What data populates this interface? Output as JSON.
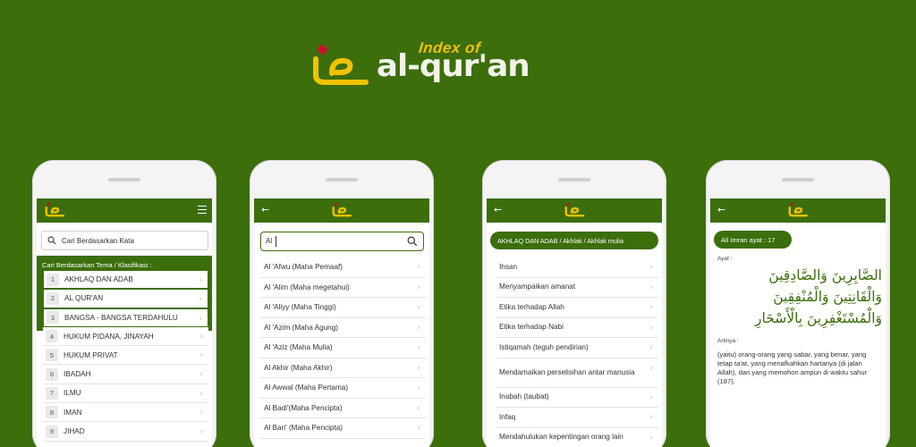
{
  "banner": {
    "index_of": "Index of",
    "title": "al-qur'an"
  },
  "phone1": {
    "search_placeholder": "Cari Berdasarkan Kata",
    "category_caption": "Cari Berdasarkan Tema / Klasifikasi :",
    "categories": [
      {
        "num": "1",
        "label": "AKHLAQ DAN ADAB"
      },
      {
        "num": "2",
        "label": "AL QUR'AN"
      },
      {
        "num": "3",
        "label": "BANGSA - BANGSA TERDAHULU"
      },
      {
        "num": "4",
        "label": "HUKUM PIDANA, JINAYAH"
      },
      {
        "num": "5",
        "label": "HUKUM PRIVAT"
      },
      {
        "num": "6",
        "label": "IBADAH"
      },
      {
        "num": "7",
        "label": "ILMU"
      },
      {
        "num": "8",
        "label": "IMAN"
      },
      {
        "num": "9",
        "label": "JIHAD"
      }
    ]
  },
  "phone2": {
    "search_value": "Al",
    "names": [
      "Al 'Afwu (Maha Pemaaf)",
      "Al 'Alim (Maha megetahui)",
      "Al 'Aliyy (Maha Tinggi)",
      "Al 'Azim (Maha Agung)",
      "Al 'Aziz (Maha Mulia)",
      "Al Akhir (Maha Akhir)",
      "Al Awwal (Maha Pertama)",
      "Al Badi'(Maha Pencipta)",
      "Al Bari' (Maha Pencipta)"
    ]
  },
  "phone3": {
    "breadcrumb": "AKHLAQ DAN ADAB / Akhlak / Akhlak mulia",
    "topics": [
      "Ihsan",
      "Menyampaikan amanat",
      "Etika terhadap Allah",
      "Etika terhadap Nabi",
      "Istiqamah (teguh pendirian)",
      "Mendamaikan perselisihan antar manusia",
      "Inabah (taubat)",
      "Infaq",
      "Mendahulukan kepentingan orang lain"
    ]
  },
  "phone4": {
    "verse_ref": "Ali Imran ayat : 17",
    "ayat_label": "Ayat :",
    "arabic_text": "الصَّابِرِينَ وَالصَّادِقِينَ وَالْقَانِتِينَ وَالْمُنْفِقِينَ وَالْمُسْتَغْفِرِينَ بِالْأَسْحَارِ",
    "artinya_label": "Artinya :",
    "translation": "(yaitu) orang-orang yang sabar, yang benar, yang tetap ta'at, yang menafkahkan hartanya (di jalan Allah), dan yang memohon ampun di waktu sahur (187)."
  },
  "colors": {
    "brand_green": "#3c6e0c",
    "logo_yellow": "#f2c200",
    "logo_red": "#c8102e"
  }
}
